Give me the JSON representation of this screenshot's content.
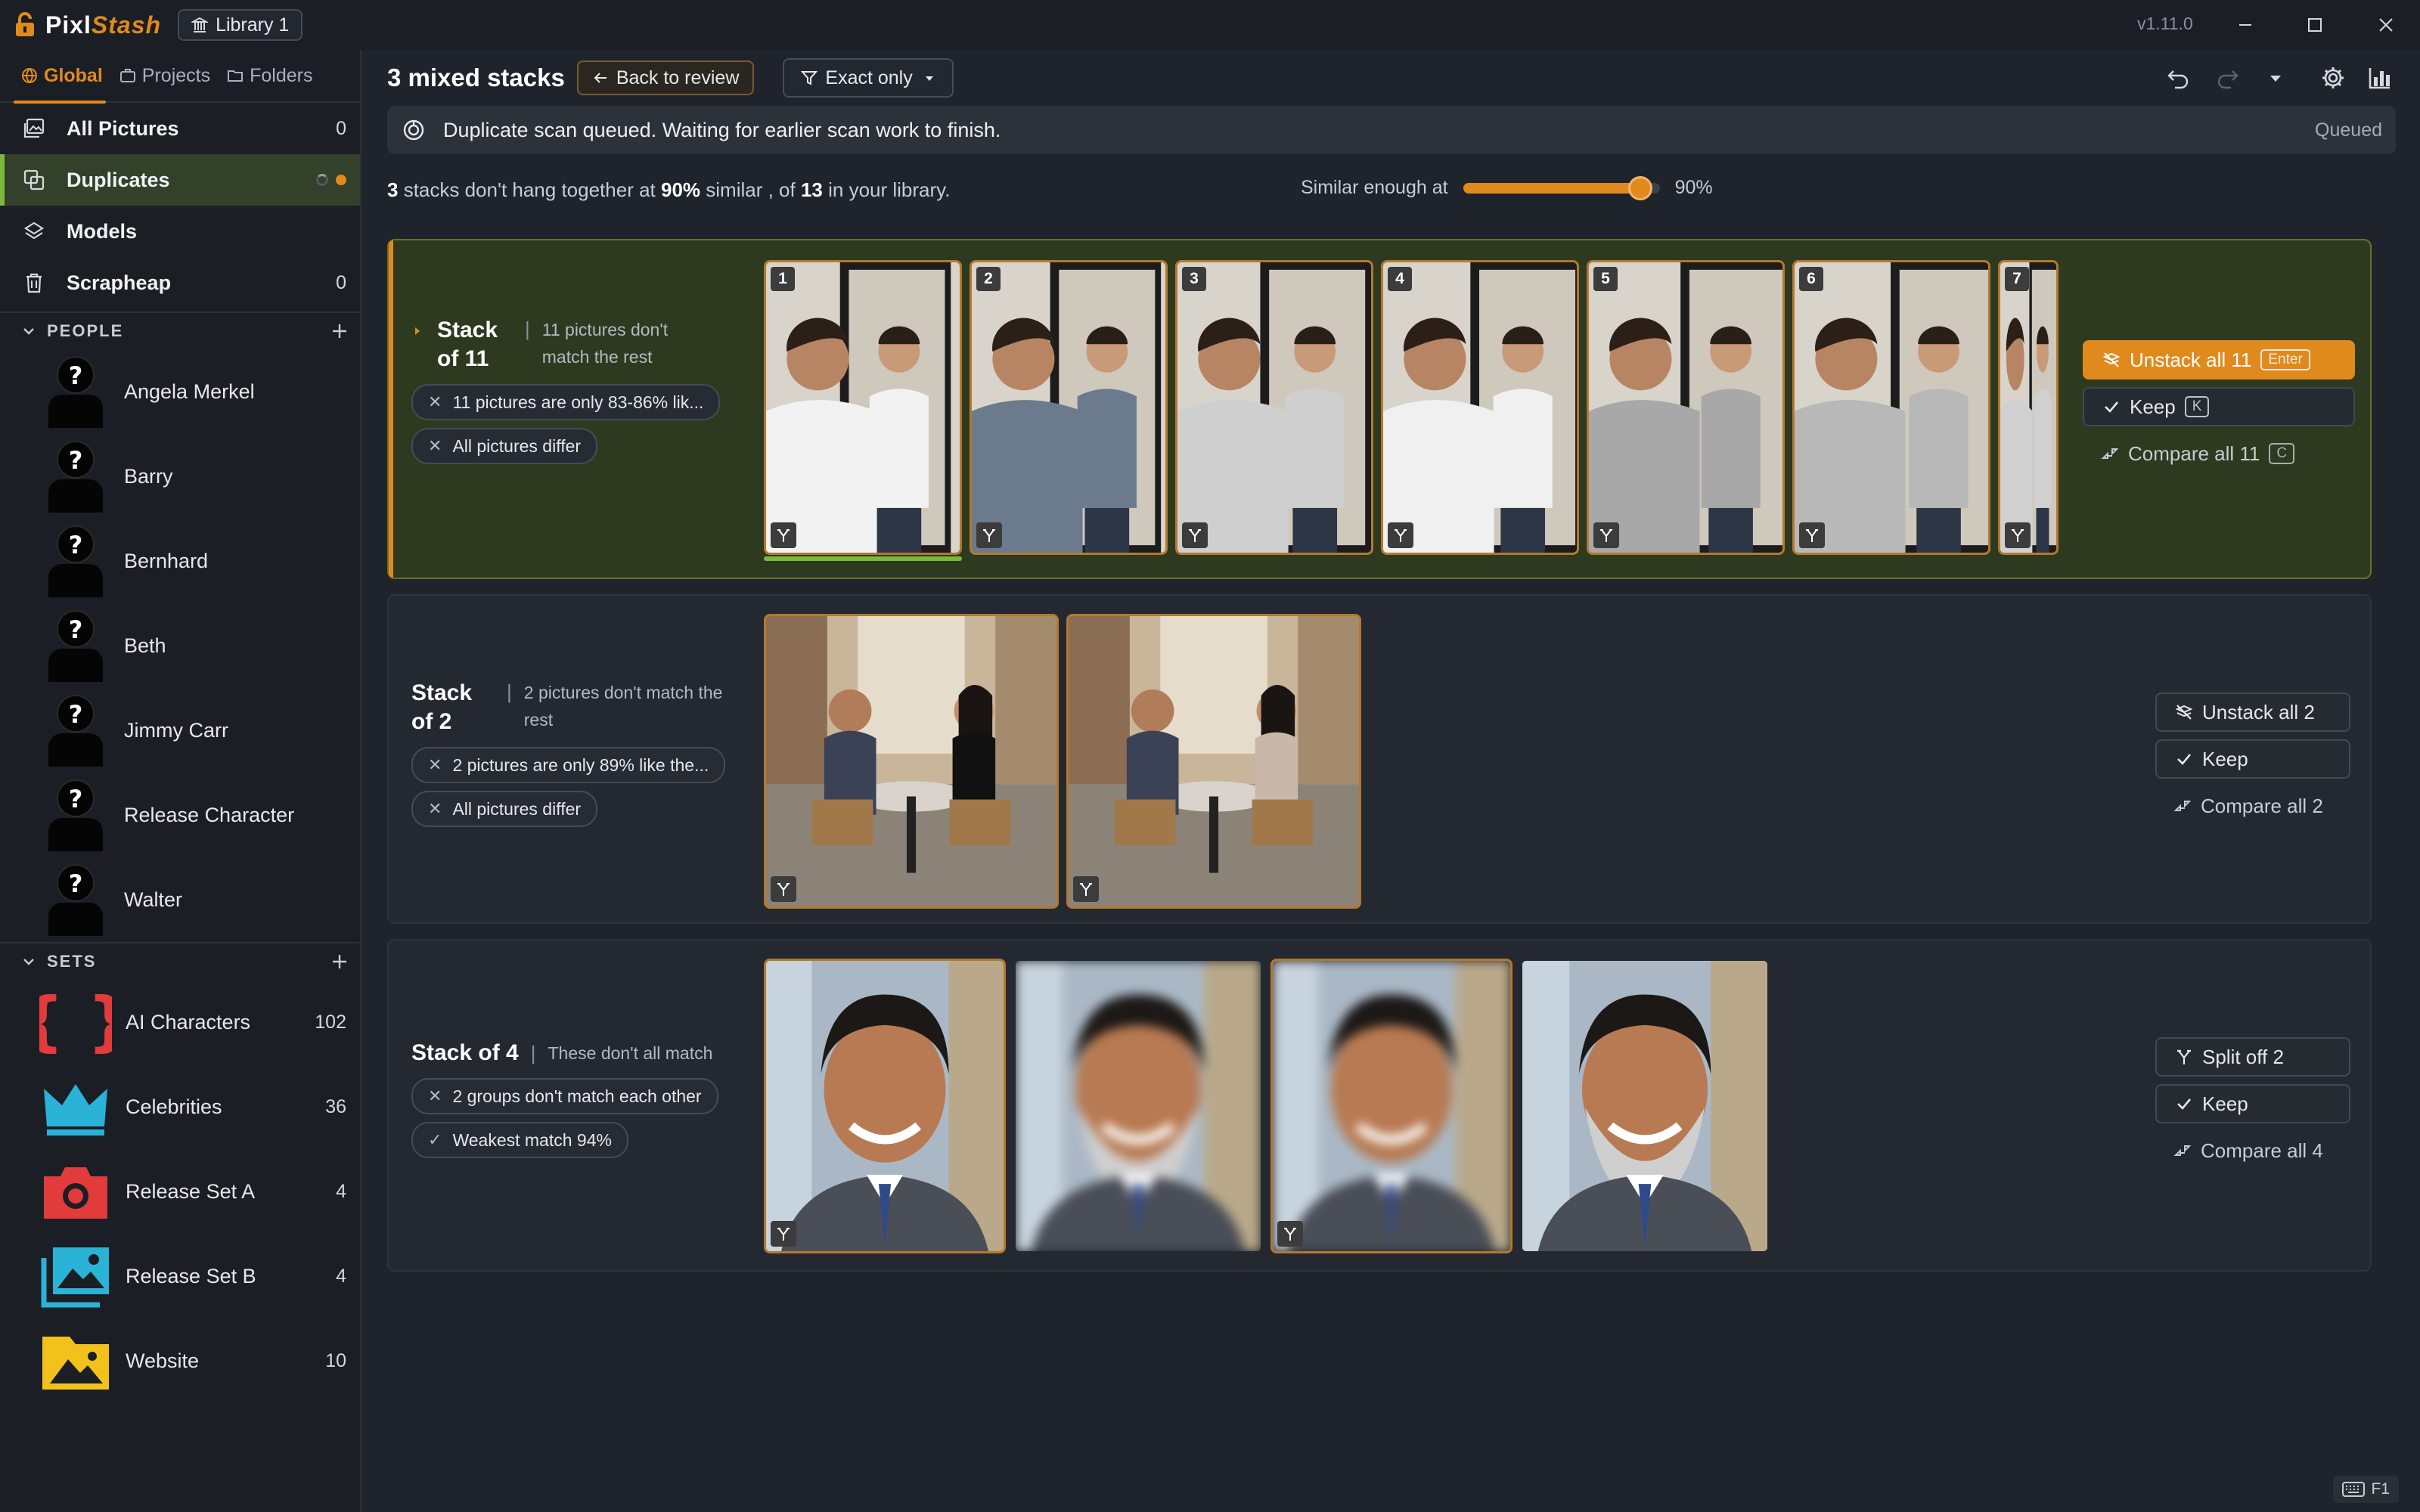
{
  "app": {
    "name_prefix": "Pixl",
    "name_suffix": "Stash",
    "library": "Library 1",
    "version": "v1.11.0"
  },
  "sidebar": {
    "tabs": [
      {
        "label": "Global",
        "active": true
      },
      {
        "label": "Projects"
      },
      {
        "label": "Folders"
      }
    ],
    "nav": [
      {
        "label": "All Pictures",
        "count": "0",
        "icon": "images-icon"
      },
      {
        "label": "Duplicates",
        "count": "",
        "icon": "duplicates-icon",
        "active": true
      },
      {
        "label": "Models",
        "count": "",
        "icon": "layers-icon"
      },
      {
        "label": "Scrapheap",
        "count": "0",
        "icon": "trash-icon"
      }
    ],
    "people_title": "PEOPLE",
    "people": [
      "Angela Merkel",
      "Barry",
      "Bernhard",
      "Beth",
      "Jimmy Carr",
      "Release Character",
      "Walter"
    ],
    "sets_title": "SETS",
    "sets": [
      {
        "label": "AI Characters",
        "count": "102",
        "icon": "braces-icon",
        "color": "#e23b3b"
      },
      {
        "label": "Celebrities",
        "count": "36",
        "icon": "crown-icon",
        "color": "#2ab3d6"
      },
      {
        "label": "Release Set A",
        "count": "4",
        "icon": "camera-icon",
        "color": "#e23b3b"
      },
      {
        "label": "Release Set B",
        "count": "4",
        "icon": "landscape-icon",
        "color": "#2ab3d6"
      },
      {
        "label": "Website",
        "count": "10",
        "icon": "image-icon",
        "color": "#f2c21b"
      }
    ]
  },
  "toolbar": {
    "title": "3 mixed stacks",
    "back": "Back to review",
    "filter": "Exact only"
  },
  "banner": {
    "message": "Duplicate scan queued. Waiting for earlier scan work to finish.",
    "status": "Queued"
  },
  "summary": {
    "stacks": "3",
    "text1": " stacks don't hang together at ",
    "pct": "90%",
    "text2": " similar , of ",
    "total": "13",
    "text3": " in your library."
  },
  "similarity": {
    "label": "Similar enough at",
    "value": "90%",
    "fraction": 0.9
  },
  "stacks": [
    {
      "title": "Stack of 11",
      "desc": "11 pictures don't match the rest",
      "chips": [
        {
          "icon": "x",
          "text": "11 pictures are only 83-86% lik..."
        },
        {
          "icon": "x",
          "text": "All pictures differ"
        }
      ],
      "thumb_numbers": [
        "1",
        "2",
        "3",
        "4",
        "5",
        "6",
        "7"
      ],
      "actions": {
        "primary": "Unstack all 11",
        "primary_key": "Enter",
        "keep": "Keep",
        "keep_key": "K",
        "compare": "Compare all 11",
        "compare_key": "C"
      }
    },
    {
      "title": "Stack of 2",
      "desc": "2 pictures don't match the rest",
      "chips": [
        {
          "icon": "x",
          "text": "2 pictures are only 89% like the..."
        },
        {
          "icon": "x",
          "text": "All pictures differ"
        }
      ],
      "actions": {
        "primary": "Unstack all 2",
        "keep": "Keep",
        "compare": "Compare all 2"
      }
    },
    {
      "title": "Stack of 4",
      "desc": "These don't all match",
      "chips": [
        {
          "icon": "x",
          "text": "2 groups don't match each other"
        },
        {
          "icon": "check",
          "text": "Weakest match 94%"
        }
      ],
      "actions": {
        "primary": "Split off 2",
        "keep": "Keep",
        "compare": "Compare all 4"
      }
    }
  ],
  "footer": {
    "shortcut": "F1"
  },
  "colors": {
    "accent": "#e08a1e",
    "selected_green": "#7bb93e"
  }
}
